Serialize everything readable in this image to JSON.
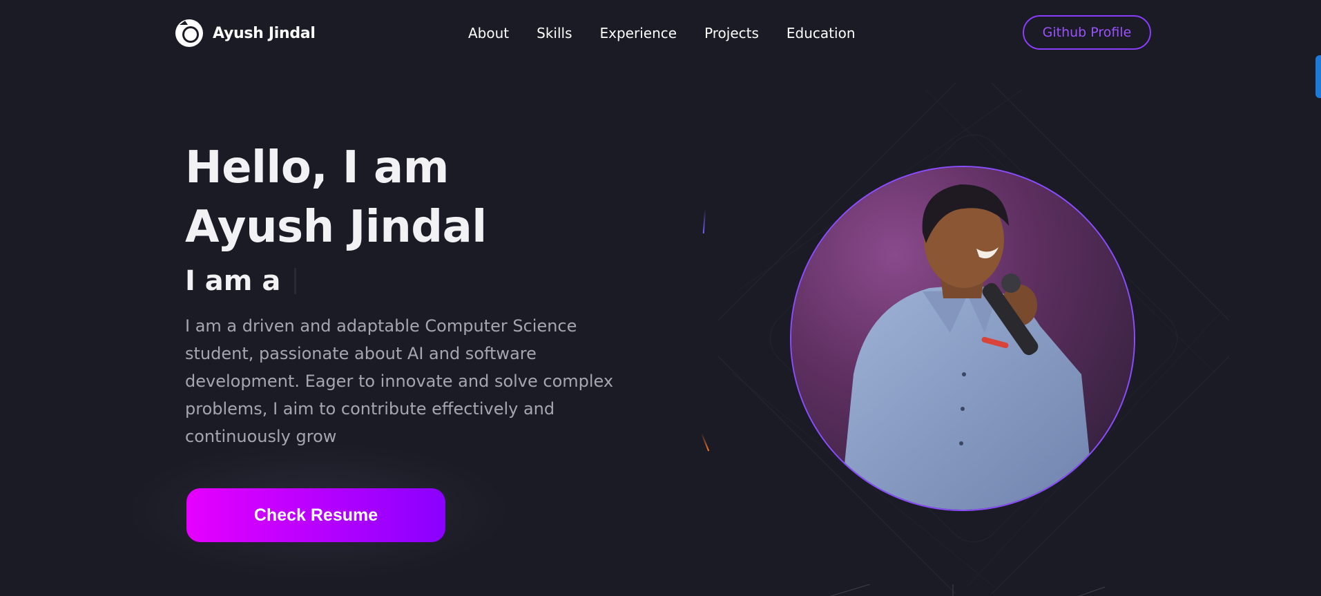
{
  "brand": {
    "name": "Ayush Jindal"
  },
  "nav": {
    "items": [
      {
        "label": "About"
      },
      {
        "label": "Skills"
      },
      {
        "label": "Experience"
      },
      {
        "label": "Projects"
      },
      {
        "label": "Education"
      }
    ],
    "github_label": "Github Profile"
  },
  "hero": {
    "greeting": "Hello, I am",
    "name": "Ayush Jindal",
    "typed_prefix": "I am a",
    "description": "I am a driven and adaptable Computer Science student, passionate about AI and software development. Eager to innovate and solve complex problems, I aim to contribute effectively and continuously grow",
    "cta_label": "Check Resume"
  },
  "colors": {
    "background": "#1b1b25",
    "accent_purple": "#8b3dff",
    "cta_gradient_start": "#e600ff",
    "cta_gradient_end": "#8a00ff",
    "text_primary": "#f2f2f5",
    "text_muted": "#a6a6b0",
    "scroll_tab": "#1e7ad8"
  },
  "icons": {
    "logo": "logo-ring-icon"
  }
}
